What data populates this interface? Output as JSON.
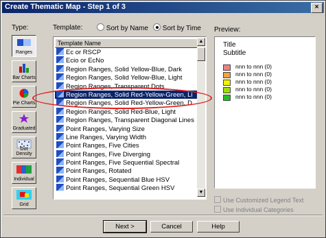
{
  "window": {
    "title": "Create Thematic Map - Step 1 of 3",
    "close": "×"
  },
  "labels": {
    "type": "Type:",
    "template": "Template:",
    "preview": "Preview:"
  },
  "sort": {
    "by_name": "Sort by Name",
    "by_time": "Sort by Time",
    "selected": "by_time"
  },
  "types": [
    {
      "label": "Ranges",
      "icon": "ranges-icon",
      "selected": true
    },
    {
      "label": "Bar Charts",
      "icon": "bar-chart-icon",
      "selected": false
    },
    {
      "label": "Pie Charts",
      "icon": "pie-chart-icon",
      "selected": false
    },
    {
      "label": "Graduated",
      "icon": "graduated-icon",
      "selected": false
    },
    {
      "label": "Dot Density",
      "icon": "dot-density-icon",
      "selected": false
    },
    {
      "label": "Individual",
      "icon": "individual-icon",
      "selected": false
    },
    {
      "label": "Grid",
      "icon": "grid-icon",
      "selected": false
    }
  ],
  "template_list": {
    "header": "Template Name",
    "selected_index": 5,
    "items": [
      "Ec or RSCP",
      "Ecio or EcNo",
      "Region Ranges, Solid Yellow-Blue, Dark",
      "Region Ranges, Solid Yellow-Blue, Light",
      "Region Ranges, Transparent Dots",
      "Region Ranges, Solid Red-Yellow-Green, Li",
      "Region Ranges, Solid Red-Yellow-Green, D",
      "Region Ranges, Solid Red-Blue, Light",
      "Region Ranges, Transparent Diagonal Lines",
      "Point Ranges, Varying Size",
      "Line Ranges, Varying Width",
      "Point Ranges, Five Cities",
      "Point Ranges, Five Diverging",
      "Point Ranges, Five Sequential Spectral",
      "Point Ranges, Rotated",
      "Point Ranges, Sequential Blue HSV",
      "Point Ranges, Sequential Green HSV"
    ]
  },
  "preview": {
    "title": "Title",
    "subtitle": "Subtitle",
    "legend": [
      {
        "text": "nnn to nnn  (0)",
        "color": "#f08080"
      },
      {
        "text": "nnn to nnn  (0)",
        "color": "#f5a23a"
      },
      {
        "text": "nnn to nnn  (0)",
        "color": "#f2f200"
      },
      {
        "text": "nnn to nnn  (0)",
        "color": "#9be000"
      },
      {
        "text": "nnn to nnn  (0)",
        "color": "#22c022"
      }
    ]
  },
  "options": {
    "custom_legend": "Use Customized Legend Text",
    "individual_categories": "Use Individual Categories"
  },
  "buttons": {
    "next": "Next >",
    "cancel": "Cancel",
    "help": "Help"
  }
}
